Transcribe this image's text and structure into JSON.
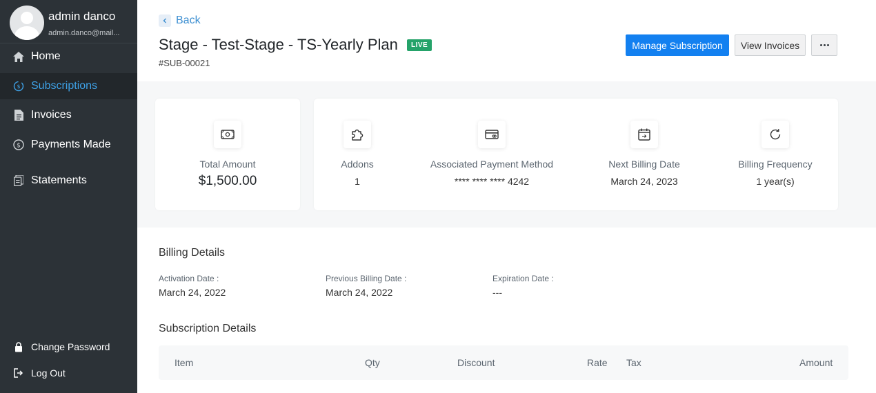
{
  "user": {
    "name": "admin danco",
    "email": "admin.danco@mail..."
  },
  "nav": {
    "items": [
      {
        "label": "Home",
        "icon": "home-icon"
      },
      {
        "label": "Subscriptions",
        "icon": "subscriptions-icon"
      },
      {
        "label": "Invoices",
        "icon": "invoice-file-icon"
      },
      {
        "label": "Payments Made",
        "icon": "dollar-circle-icon"
      },
      {
        "label": "Statements",
        "icon": "statement-copy-icon"
      }
    ],
    "bottom": [
      {
        "label": "Change Password",
        "icon": "lock-icon"
      },
      {
        "label": "Log Out",
        "icon": "logout-icon"
      }
    ]
  },
  "header": {
    "back_label": "Back",
    "title": "Stage - Test-Stage - TS-Yearly Plan",
    "status_badge": "LIVE",
    "subscription_id": "#SUB-00021",
    "manage_button": "Manage Subscription",
    "invoices_button": "View Invoices"
  },
  "summary": {
    "total_amount_label": "Total Amount",
    "total_amount_value": "$1,500.00",
    "addons_label": "Addons",
    "addons_value": "1",
    "payment_method_label": "Associated Payment Method",
    "payment_method_value": "**** **** **** 4242",
    "next_billing_label": "Next Billing Date",
    "next_billing_value": "March 24, 2023",
    "frequency_label": "Billing Frequency",
    "frequency_value": "1 year(s)"
  },
  "billing": {
    "title": "Billing Details",
    "activation_label": "Activation Date :",
    "activation_value": "March 24, 2022",
    "previous_label": "Previous Billing Date :",
    "previous_value": "March 24, 2022",
    "expiration_label": "Expiration Date :",
    "expiration_value": "---"
  },
  "subscription_details": {
    "title": "Subscription Details",
    "columns": [
      "Item",
      "Qty",
      "Discount",
      "Rate",
      "Tax",
      "Amount"
    ]
  },
  "colors": {
    "sidebar_bg": "#2c3237",
    "active_text": "#3ea2e8",
    "primary_button": "#1380f0",
    "live_badge": "#25a36a"
  }
}
